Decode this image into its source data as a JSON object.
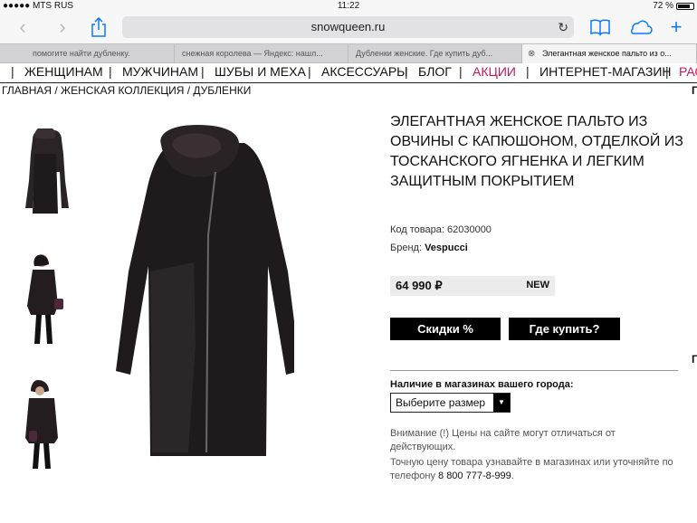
{
  "status": {
    "carrier": "●●●●● MTS RUS",
    "time": "11:22",
    "battery": "72 %"
  },
  "toolbar": {
    "url": "snowqueen.ru"
  },
  "tabs": [
    "помогите найти дубленку.",
    "снежная королева — Яндекс: нашл...",
    "Дубленки женские. Где купить дуб...",
    "Элегантная женское пальто из о..."
  ],
  "nav": {
    "items": [
      "ЖЕНЩИНАМ",
      "МУЖЧИНАМ",
      "ШУБЫ И МЕХА",
      "АКСЕССУАРЫ",
      "БЛОГ",
      "АКЦИИ",
      "ИНТЕРНЕТ-МАГАЗИН",
      "РАС"
    ],
    "accent_color": "#c2185b"
  },
  "breadcrumb": "ГЛАВНАЯ / ЖЕНСКАЯ КОЛЛЕКЦИЯ / ДУБЛЕНКИ",
  "product": {
    "title": "ЭЛЕГАНТНАЯ ЖЕНСКОЕ ПАЛЬТО ИЗ ОВЧИНЫ С КАПЮШОНОМ, ОТДЕЛКОЙ ИЗ ТОСКАНСКОГО ЯГНЕНКА И ЛЕГКИМ ЗАЩИТНЫМ ПОКРЫТИЕМ",
    "code_label": "Код товара:",
    "code": "62030000",
    "brand_label": "Бренд:",
    "brand": "Vespucci",
    "price": "64 990 ₽",
    "badge": "NEW",
    "discount_button": "Скидки %",
    "where_button": "Где купить?",
    "availability_label": "Наличие в магазинах вашего города:",
    "size_select": "Выберите размер",
    "notice_1": "Внимание (!) Цены на сайте могут отличаться от действующих.",
    "notice_2": "Точную цену товара узнавайте в магазинах или уточняйте по телефону",
    "phone": "8 800 777-8-999",
    "phone_suffix": "."
  },
  "edge": [
    "Г",
    "Г"
  ]
}
